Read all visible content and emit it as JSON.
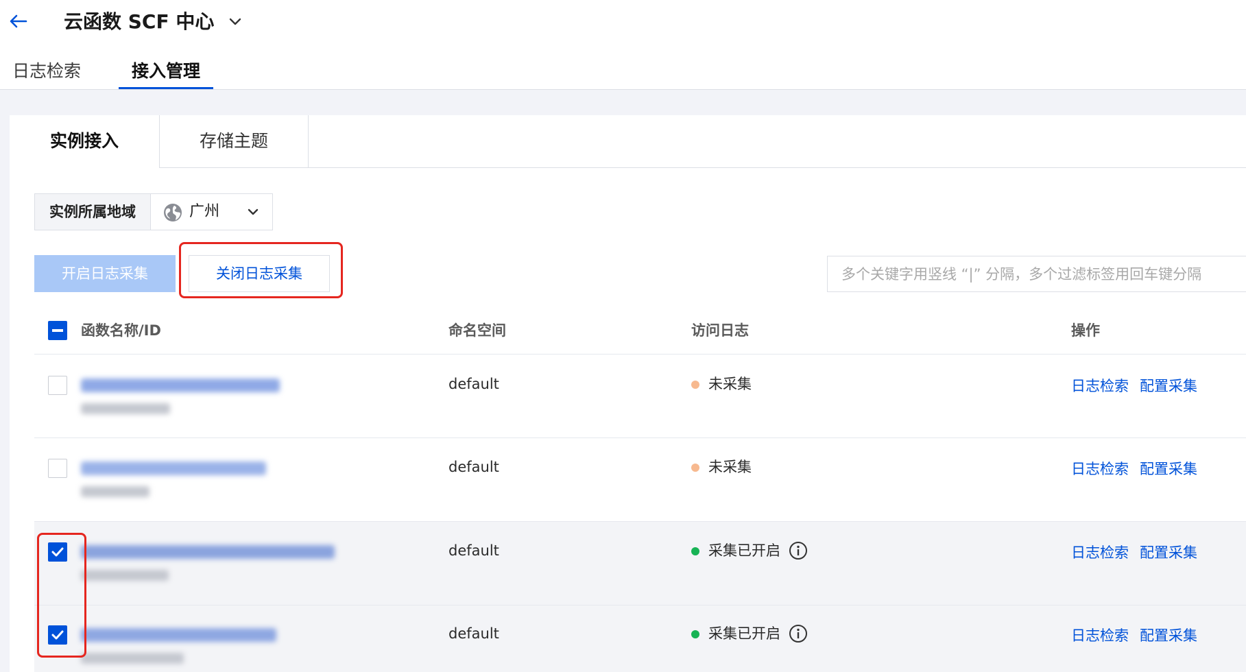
{
  "header": {
    "title": "云函数 SCF 中心",
    "back_icon": "arrow-left-icon",
    "title_menu_icon": "chevron-down-icon"
  },
  "top_tabs": [
    {
      "label": "日志检索",
      "active": false
    },
    {
      "label": "接入管理",
      "active": true
    }
  ],
  "sub_tabs": [
    {
      "label": "实例接入",
      "active": true
    },
    {
      "label": "存储主题",
      "active": false
    }
  ],
  "region": {
    "label": "实例所属地域",
    "value": "广州",
    "icon": "globe-icon"
  },
  "actions": {
    "enable_label": "开启日志采集",
    "disable_label": "关闭日志采集"
  },
  "search": {
    "placeholder": "多个关键字用竖线 “|” 分隔，多个过滤标签用回车键分隔"
  },
  "table": {
    "columns": [
      "函数名称/ID",
      "命名空间",
      "访问日志",
      "操作"
    ],
    "rows": [
      {
        "checked": false,
        "namespace": "default",
        "status": "未采集",
        "status_color": "#f7b98f",
        "info": false,
        "op_search": "日志检索",
        "op_config": "配置采集"
      },
      {
        "checked": false,
        "namespace": "default",
        "status": "未采集",
        "status_color": "#f7b98f",
        "info": false,
        "op_search": "日志检索",
        "op_config": "配置采集"
      },
      {
        "checked": true,
        "namespace": "default",
        "status": "采集已开启",
        "status_color": "#17b355",
        "info": true,
        "op_search": "日志检索",
        "op_config": "配置采集"
      },
      {
        "checked": true,
        "namespace": "default",
        "status": "采集已开启",
        "status_color": "#17b355",
        "info": true,
        "op_search": "日志检索",
        "op_config": "配置采集"
      }
    ]
  },
  "colors": {
    "primary": "#0052d9",
    "primary_disabled": "#a9c8f7",
    "highlight": "#e5261f"
  }
}
